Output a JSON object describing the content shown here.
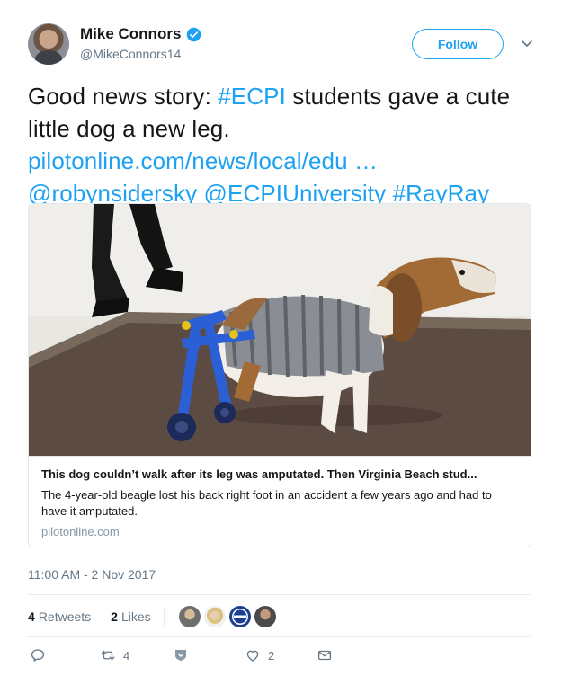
{
  "author": {
    "display_name": "Mike Connors",
    "handle": "@MikeConnors14",
    "avatar_icon": "user-avatar",
    "verified_icon": "verified-badge-icon"
  },
  "follow_label": "Follow",
  "tweet": {
    "text_plain": "Good news story: ",
    "hashtag_ecpi": "#ECPI",
    "text_rest": " students gave a cute little dog a new leg.",
    "link": "pilotonline.com/news/local/edu …",
    "mention_1": "@robynsidersky",
    "mention_2": "@ECPIUniversity",
    "hashtag_rayray": "#RayRay"
  },
  "card": {
    "title": "This dog couldn’t walk after its leg was amputated. Then Virginia Beach stud...",
    "description": "The 4-year-old beagle lost his back right foot in an accident a few years ago and had to have it amputated.",
    "domain": "pilotonline.com"
  },
  "timestamp": "11:00 AM - 2 Nov 2017",
  "stats": {
    "retweets_count": "4",
    "retweets_label": "Retweets",
    "likes_count": "2",
    "likes_label": "Likes"
  },
  "actions": {
    "reply_count": "",
    "retweet_count": "4",
    "like_count": "2"
  },
  "colors": {
    "link_blue": "#1da1f2",
    "muted_gray": "#657786",
    "border": "#e1e8ed"
  }
}
